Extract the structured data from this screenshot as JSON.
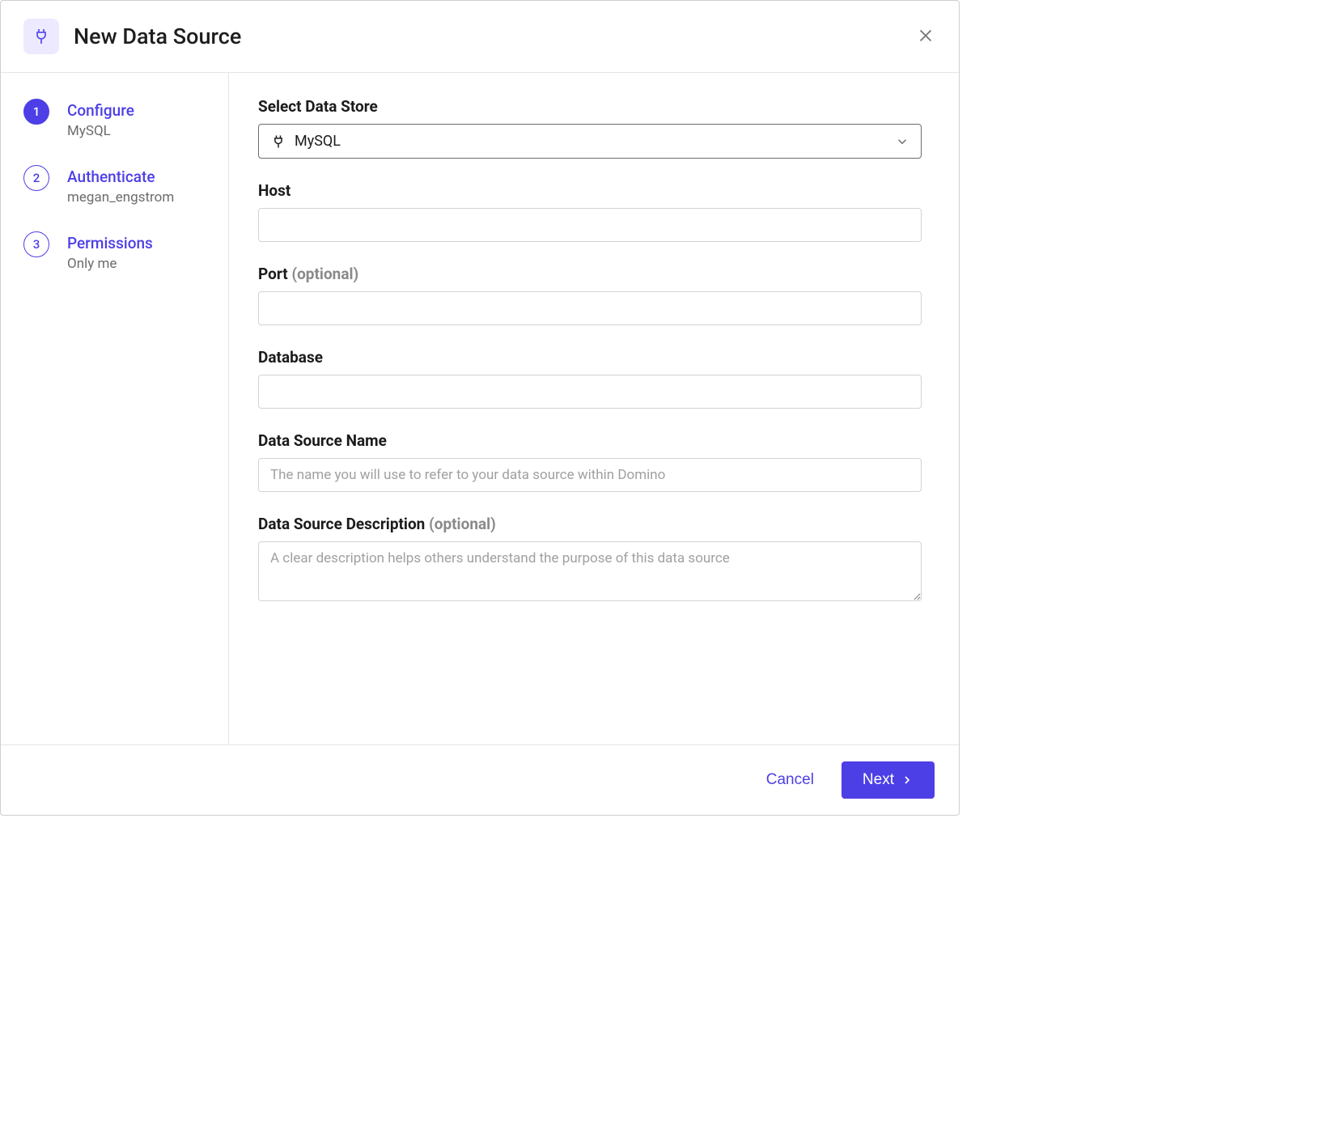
{
  "header": {
    "title": "New Data Source"
  },
  "steps": [
    {
      "number": "1",
      "title": "Configure",
      "sub": "MySQL",
      "active": true
    },
    {
      "number": "2",
      "title": "Authenticate",
      "sub": "megan_engstrom",
      "active": false
    },
    {
      "number": "3",
      "title": "Permissions",
      "sub": "Only me",
      "active": false
    }
  ],
  "form": {
    "select_store": {
      "label": "Select Data Store",
      "selected": "MySQL"
    },
    "host": {
      "label": "Host",
      "value": ""
    },
    "port": {
      "label": "Port",
      "optional": "(optional)",
      "value": ""
    },
    "database": {
      "label": "Database",
      "value": ""
    },
    "name": {
      "label": "Data Source Name",
      "placeholder": "The name you will use to refer to your data source within Domino",
      "value": ""
    },
    "desc": {
      "label": "Data Source Description",
      "optional": "(optional)",
      "placeholder": "A clear description helps others understand the purpose of this data source",
      "value": ""
    }
  },
  "footer": {
    "cancel": "Cancel",
    "next": "Next"
  }
}
